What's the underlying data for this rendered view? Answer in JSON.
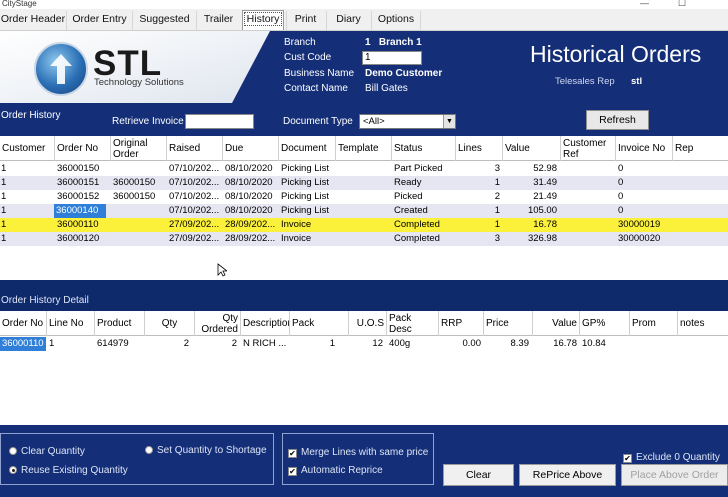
{
  "window": {
    "title": "CityStage",
    "minimize": "—",
    "maximize": "☐"
  },
  "tabs": [
    "Order Header",
    "Order Entry",
    "Suggested",
    "Trailer",
    "History",
    "Print",
    "Diary",
    "Options"
  ],
  "active_tab": "History",
  "logo": {
    "name": "STL",
    "tagline": "Technology Solutions"
  },
  "header": {
    "branch_label": "Branch",
    "branch_value": "1   Branch 1",
    "cust_code_label": "Cust Code",
    "cust_code_value": "1",
    "business_name_label": "Business Name",
    "business_name_value": "Demo Customer",
    "contact_name_label": "Contact Name",
    "contact_name_value": "Bill Gates",
    "page_title": "Historical Orders",
    "telesales_rep_label": "Telesales Rep",
    "telesales_rep_value": "stl"
  },
  "filters": {
    "order_history_label": "Order History",
    "retrieve_invoice_label": "Retrieve Invoice",
    "retrieve_invoice_value": "",
    "document_type_label": "Document Type",
    "document_type_value": "<All>",
    "refresh_label": "Refresh"
  },
  "order_history": {
    "columns": [
      "Customer",
      "Order No",
      "Original Order",
      "Raised",
      "Due",
      "Document",
      "Template",
      "Status",
      "Lines",
      "Value",
      "Customer Ref",
      "Invoice No",
      "Rep"
    ],
    "rows": [
      [
        "1",
        "36000150",
        "",
        "07/10/202...",
        "08/10/2020",
        "Picking List",
        "",
        "Part Picked",
        "3",
        "52.98",
        "",
        "0",
        ""
      ],
      [
        "1",
        "36000151",
        "36000150",
        "07/10/202...",
        "08/10/2020",
        "Picking List",
        "",
        "Ready",
        "1",
        "31.49",
        "",
        "0",
        ""
      ],
      [
        "1",
        "36000152",
        "36000150",
        "07/10/202...",
        "08/10/2020",
        "Picking List",
        "",
        "Picked",
        "2",
        "21.49",
        "",
        "0",
        ""
      ],
      [
        "1",
        "36000140",
        "",
        "07/10/202...",
        "08/10/2020",
        "Picking List",
        "",
        "Created",
        "1",
        "105.00",
        "",
        "0",
        ""
      ],
      [
        "1",
        "36000110",
        "",
        "27/09/202...",
        "28/09/202...",
        "Invoice",
        "",
        "Completed",
        "1",
        "16.78",
        "",
        "30000019",
        ""
      ],
      [
        "1",
        "36000120",
        "",
        "27/09/202...",
        "28/09/202...",
        "Invoice",
        "",
        "Completed",
        "3",
        "326.98",
        "",
        "30000020",
        ""
      ]
    ],
    "highlighted_row": 4,
    "selected_cell": "36000140"
  },
  "detail": {
    "label": "Order History Detail",
    "columns": [
      "Order No",
      "Line No",
      "Product",
      "Qty",
      "Qty Ordered",
      "Description",
      "Pack",
      "U.O.S",
      "Pack Desc",
      "RRP",
      "Price",
      "Value",
      "GP%",
      "Prom",
      "notes"
    ],
    "rows": [
      [
        "36000110",
        "1",
        "614979",
        "2",
        "2",
        "N RICH ...",
        "1",
        "12",
        "400g",
        "0.00",
        "8.39",
        "16.78",
        "10.84",
        "",
        ""
      ]
    ]
  },
  "options": {
    "clear_quantity": "Clear Quantity",
    "set_quantity_to_shortage": "Set Quantity to Shortage",
    "reuse_existing_quantity": "Reuse Existing Quantity",
    "merge_lines": "Merge Lines with same price",
    "automatic_reprice": "Automatic Reprice",
    "exclude_zero_quantity": "Exclude 0 Quantity",
    "check_mark": "✔"
  },
  "buttons": {
    "clear": "Clear",
    "reprice_above": "RePrice Above",
    "place_above_order": "Place Above Order"
  },
  "colors": {
    "header_bg": "#142f78",
    "highlight_row": "#fbf03a",
    "selection": "#2f7fd8",
    "alt_row": "#e6e6f2"
  }
}
